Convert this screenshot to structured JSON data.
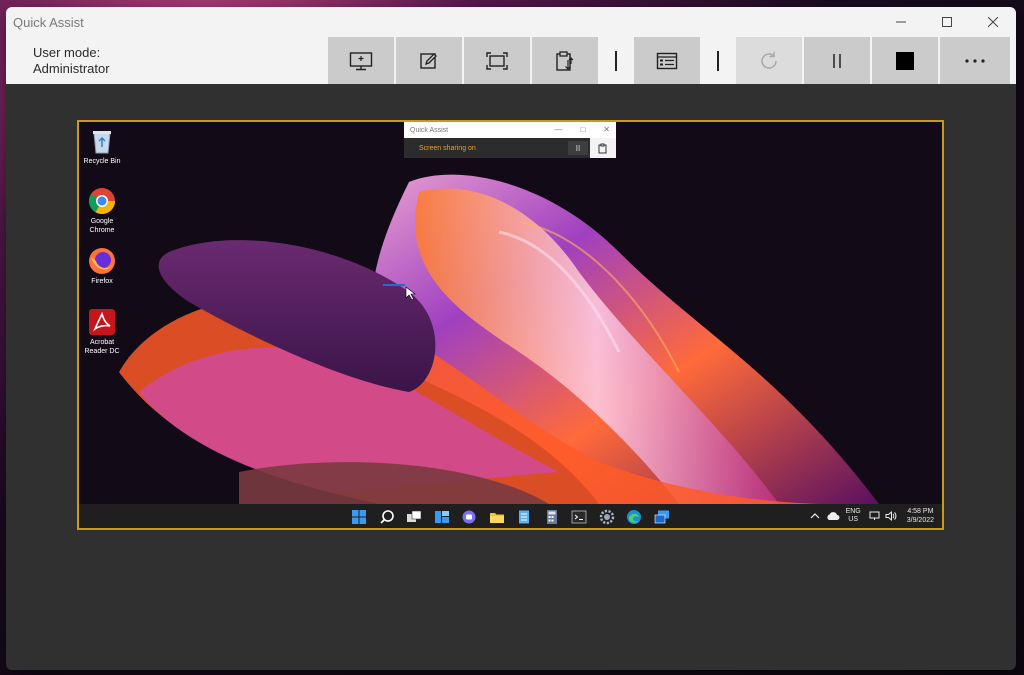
{
  "window": {
    "title": "Quick Assist",
    "controls": [
      "minimize-icon",
      "maximize-icon",
      "close-icon"
    ]
  },
  "toolbar": {
    "user_mode_label": "User mode:",
    "user_mode_value": "Administrator",
    "tools": [
      {
        "name": "select-monitor",
        "icon": "monitor-icon"
      },
      {
        "name": "annotate",
        "icon": "pencil-icon"
      },
      {
        "name": "actual-size",
        "icon": "fit-screen-icon"
      },
      {
        "name": "toggle-instruction-channel",
        "icon": "clipboard-icon"
      },
      {
        "name": "task-manager",
        "icon": "task-manager-icon"
      },
      {
        "name": "restart",
        "icon": "refresh-icon",
        "disabled": true
      },
      {
        "name": "pause",
        "icon": "pause-icon"
      },
      {
        "name": "end",
        "icon": "stop-icon"
      },
      {
        "name": "more",
        "icon": "more-icon"
      }
    ]
  },
  "remote": {
    "desktop_icons": [
      {
        "label": "Recycle Bin",
        "icon": "recycle-bin-icon"
      },
      {
        "label": "Google Chrome",
        "icon": "chrome-icon"
      },
      {
        "label": "Firefox",
        "icon": "firefox-icon"
      },
      {
        "label": "Acrobat Reader DC",
        "icon": "acrobat-icon"
      }
    ],
    "mini_window": {
      "title": "Quick Assist",
      "status": "Screen sharing on",
      "pause_glyph": "II"
    },
    "taskbar": {
      "lang_top": "ENG",
      "lang_bottom": "US",
      "time": "4:58 PM",
      "date": "3/9/2022",
      "pinned": [
        "start-icon",
        "search-icon",
        "task-view-icon",
        "widgets-icon",
        "chat-icon",
        "file-explorer-icon",
        "notepad-icon",
        "calculator-icon",
        "terminal-icon",
        "settings-icon",
        "edge-icon",
        "quick-assist-icon"
      ]
    }
  },
  "colors": {
    "share_border": "#c89a1a",
    "status_text": "#f0a020"
  }
}
